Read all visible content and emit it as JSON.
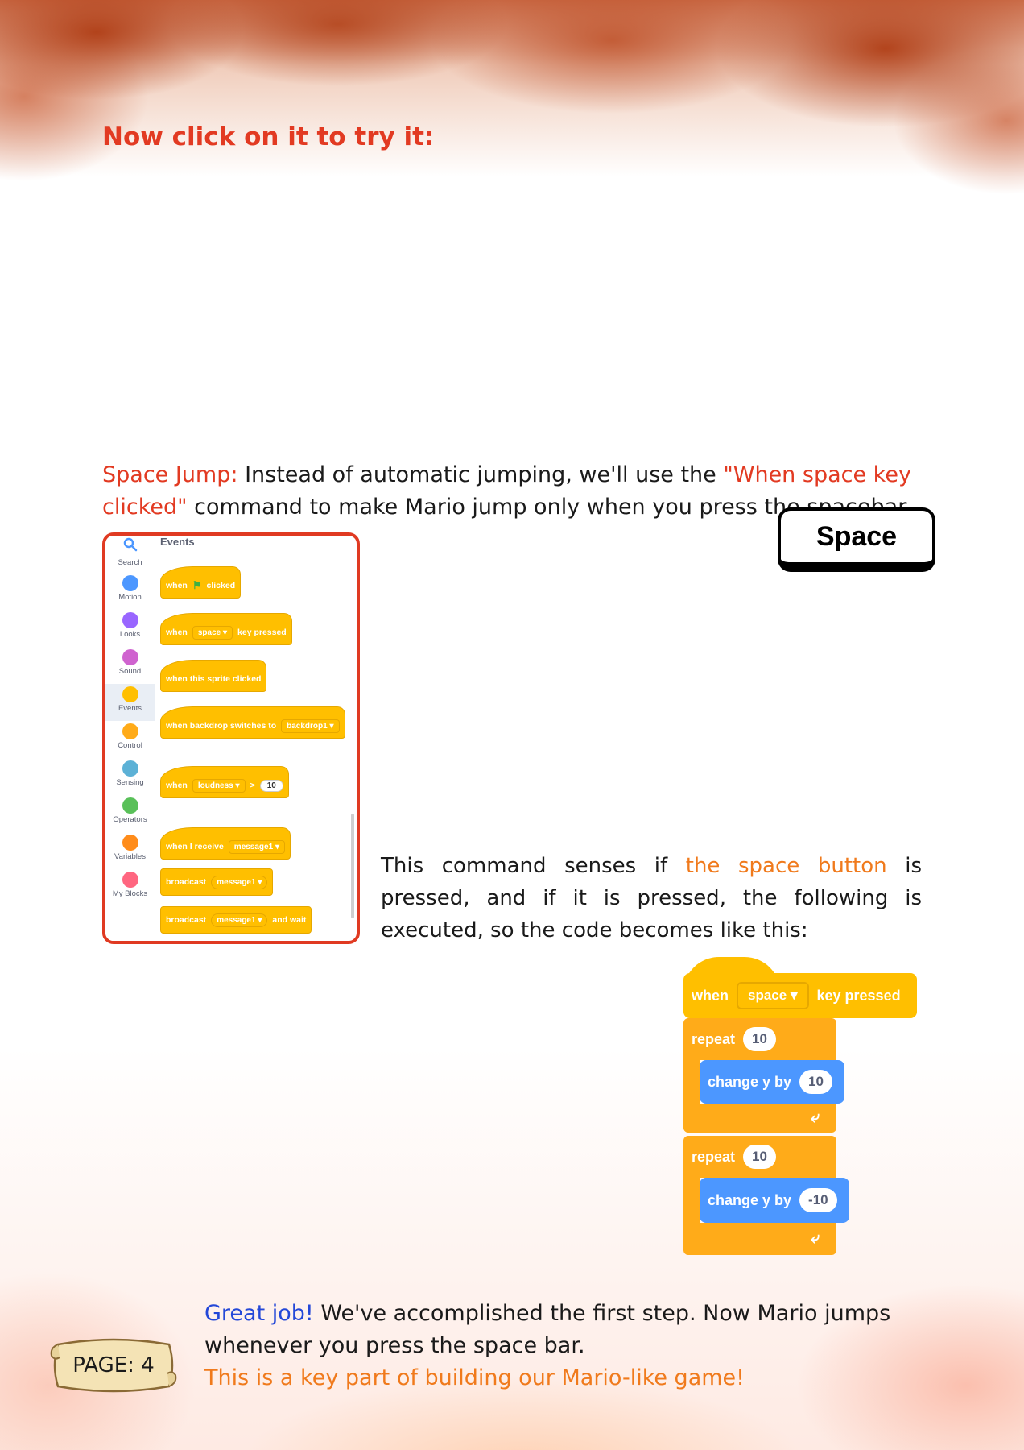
{
  "heading": "Now click on it to try it:",
  "space_jump": {
    "label": "Space Jump:",
    "text1": " Instead of automatic jumping, we'll use the ",
    "quote": "\"When space key clicked\"",
    "text2": " command to make Mario jump only when you press the spacebar."
  },
  "space_key": "Space",
  "palette": {
    "title": "Events",
    "categories": [
      {
        "label": "Search",
        "icon": "search-icon",
        "color": "#4c97ff"
      },
      {
        "label": "Motion",
        "color": "#4c97ff"
      },
      {
        "label": "Looks",
        "color": "#9966ff"
      },
      {
        "label": "Sound",
        "color": "#cf63cf"
      },
      {
        "label": "Events",
        "color": "#ffbf00"
      },
      {
        "label": "Control",
        "color": "#ffab19"
      },
      {
        "label": "Sensing",
        "color": "#5cb1d6"
      },
      {
        "label": "Operators",
        "color": "#59c059"
      },
      {
        "label": "Variables",
        "color": "#ff8c1a"
      },
      {
        "label": "My Blocks",
        "color": "#ff6680"
      }
    ],
    "blocks": {
      "flag_when": "when",
      "flag_clicked": "clicked",
      "key_when": "when",
      "key_value": "space",
      "key_pressed": "key pressed",
      "sprite_clicked": "when this sprite clicked",
      "backdrop_label": "when backdrop switches to",
      "backdrop_value": "backdrop1",
      "loud_when": "when",
      "loud_value": "loudness",
      "loud_op": ">",
      "loud_num": "10",
      "receive_label": "when I receive",
      "receive_value": "message1",
      "broadcast_label": "broadcast",
      "broadcast_value": "message1",
      "broadcast_wait_label": "broadcast",
      "broadcast_wait_value": "message1",
      "broadcast_wait_suffix": "and wait"
    }
  },
  "explain": {
    "text1": "This command senses if ",
    "highlight": "the space button",
    "text2": " is pressed, and if it is pressed, the following is executed, so the code becomes like this:"
  },
  "code": {
    "when": "when",
    "key": "space",
    "key_pressed": "key pressed",
    "repeat1": "repeat",
    "repeat1_count": "10",
    "change1": "change y by",
    "change1_value": "10",
    "repeat2": "repeat",
    "repeat2_count": "10",
    "change2": "change y by",
    "change2_value": "-10"
  },
  "page_banner": "PAGE: 4",
  "closing": {
    "great": "Great job!",
    "text": " We've accomplished the first step. Now Mario jumps whenever you press the space bar.",
    "key_part": "This is a key part of building our Mario-like game!"
  }
}
